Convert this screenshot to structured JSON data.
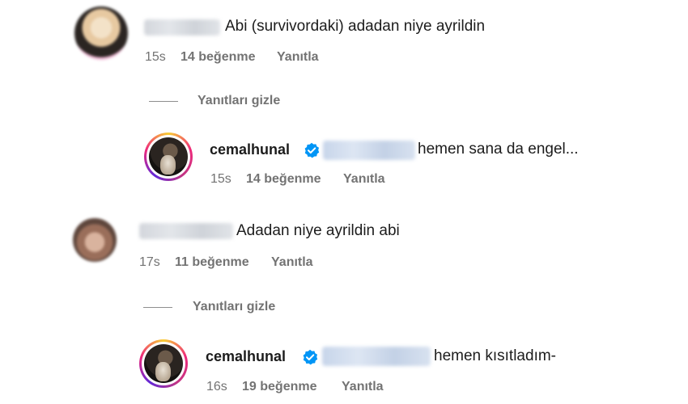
{
  "comments": [
    {
      "text": "Abi (survivordaki) adadan niye ayrildin",
      "time": "15s",
      "likes": "14 beğenme",
      "reply": "Yanıtla"
    },
    {
      "text": "Adadan niye ayrildin abi",
      "time": "17s",
      "likes": "11 beğenme",
      "reply": "Yanıtla"
    }
  ],
  "hide_replies_label": "Yanıtları gizle",
  "replies": [
    {
      "username": "cemalhunal",
      "text": "hemen sana da engel...",
      "time": "15s",
      "likes": "14 beğenme",
      "reply": "Yanıtla"
    },
    {
      "username": "cemalhunal",
      "text": "hemen kısıtladım-",
      "time": "16s",
      "likes": "19 beğenme",
      "reply": "Yanıtla"
    }
  ],
  "colors": {
    "verified": "#0095f6",
    "meta": "#737373"
  }
}
